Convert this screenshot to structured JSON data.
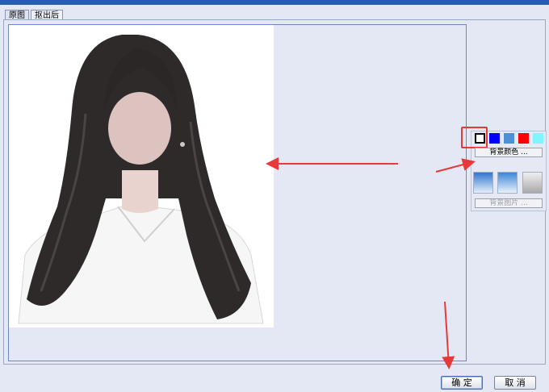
{
  "tabs": [
    {
      "label": "原图"
    },
    {
      "label": "抠出后"
    }
  ],
  "background_panel": {
    "colors": [
      "#ffffff",
      "#0000ff",
      "#4f8fd8",
      "#ff0000",
      "#7ff5ff"
    ],
    "color_button_label": "背景颜色 ...",
    "image_button_label": "背景图片 ..."
  },
  "footer": {
    "ok_label": "确 定",
    "cancel_label": "取 消"
  },
  "accent": {
    "annotation": "#e8393a",
    "viewer_border": "#6f87c4"
  }
}
